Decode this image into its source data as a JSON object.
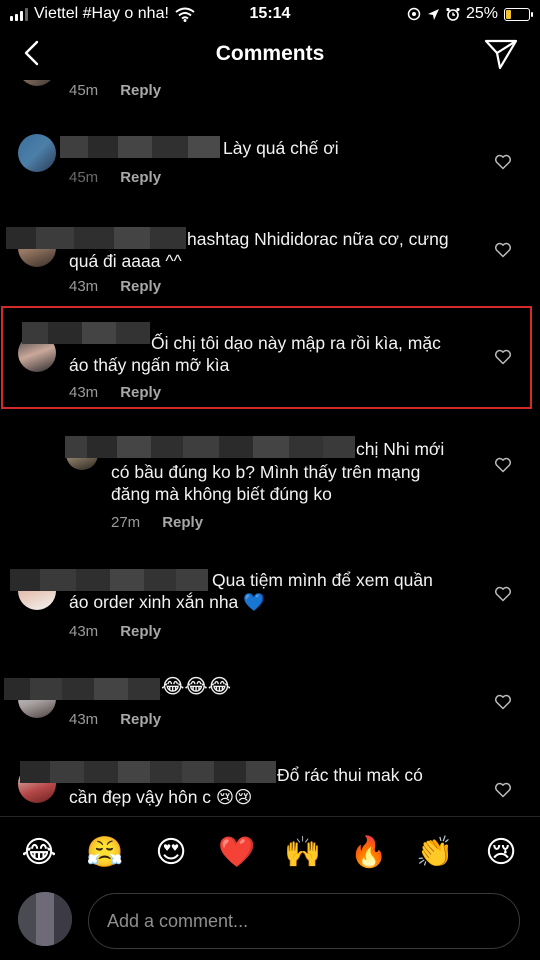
{
  "status_bar": {
    "carrier": "Viettel #Hay o nha!",
    "time": "15:14",
    "battery": "25%",
    "battery_level": 0.25,
    "icons": [
      "signal-icon",
      "wifi-icon",
      "location-icon",
      "alarm-icon",
      "battery-icon"
    ]
  },
  "header": {
    "title": "Comments",
    "back_icon": "chevron-left-icon",
    "send_icon": "paper-plane-icon"
  },
  "comments": [
    {
      "text": "",
      "time": "45m",
      "reply": "Reply"
    },
    {
      "text": "Lày quá chế ơi",
      "time": "45m",
      "reply": "Reply"
    },
    {
      "text_line1": "hashtag Nhididorac nữa cơ, cưng",
      "text_line2": "quá đi aaaa ^^",
      "time": "43m",
      "reply": "Reply"
    },
    {
      "text_line1": "Ối chị tôi dạo này mập ra rồi kìa, mặc",
      "text_line2": "áo thấy ngấn mỡ kìa",
      "time": "43m",
      "reply": "Reply",
      "highlighted": true
    },
    {
      "text_line1": "chị Nhi mới",
      "text_line2": "có bầu đúng ko b? Mình thấy trên mạng",
      "text_line3": "đăng mà không biết đúng ko",
      "time": "27m",
      "reply": "Reply",
      "is_reply": true
    },
    {
      "text_line1": "Qua tiệm mình để xem quần",
      "text_line2": "áo order xinh xắn nha 💙",
      "time": "43m",
      "reply": "Reply"
    },
    {
      "text_line1": "😂😂😂",
      "time": "43m",
      "reply": "Reply"
    },
    {
      "text_line1": "Đổ rác thui mak có",
      "text_line2": "cần đẹp vậy hôn c 😢😢"
    }
  ],
  "emoji_bar": [
    "😂",
    "😤",
    "😍",
    "❤️",
    "🙌",
    "🔥",
    "👏",
    "😢"
  ],
  "input": {
    "placeholder": "Add a comment..."
  },
  "colors": {
    "background": "#000000",
    "highlight_border": "#d42a2a",
    "meta_text": "#9a9a9a"
  }
}
